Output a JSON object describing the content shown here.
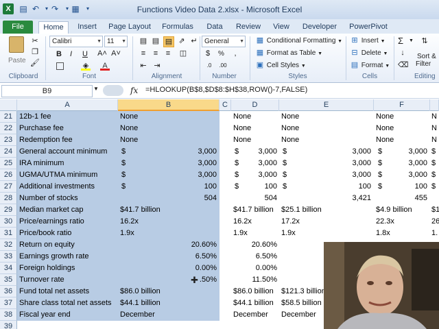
{
  "window": {
    "title": "Functions Video Data 2.xlsx - Microsoft Excel"
  },
  "tabs": [
    "File",
    "Home",
    "Insert",
    "Page Layout",
    "Formulas",
    "Data",
    "Review",
    "View",
    "Developer",
    "PowerPivot"
  ],
  "ribbon": {
    "groups": {
      "clipboard": "Clipboard",
      "font": "Font",
      "alignment": "Alignment",
      "number": "Number",
      "styles": "Styles",
      "cells": "Cells",
      "editing": "Editing"
    },
    "paste_label": "Paste",
    "font_name": "Calibri",
    "font_size": "11",
    "number_format": "General",
    "conditional_formatting": "Conditional Formatting",
    "format_as_table": "Format as Table",
    "cell_styles": "Cell Styles",
    "insert": "Insert",
    "delete": "Delete",
    "format": "Format",
    "sort_filter_1": "Sort &",
    "sort_filter_2": "Filter",
    "bold": "B",
    "italic": "I",
    "underline": "U",
    "sigma": "Σ",
    "percent": "%",
    "fx": "fx"
  },
  "formula_bar": {
    "name_box": "B9",
    "formula": "=HLOOKUP(B$8,$D$8:$H$38,ROW()-7,FALSE)"
  },
  "columns": [
    "A",
    "B",
    "C",
    "D",
    "E",
    "F"
  ],
  "rows": [
    {
      "num": "21",
      "a": "12b-1 fee",
      "b": "None",
      "b_sym": "",
      "d": "None",
      "d_sym": "",
      "e": "None",
      "e_sym": "",
      "f": "None",
      "f_sym": "",
      "g": "N"
    },
    {
      "num": "22",
      "a": "Purchase fee",
      "b": "None",
      "b_sym": "",
      "d": "None",
      "d_sym": "",
      "e": "None",
      "e_sym": "",
      "f": "None",
      "f_sym": "",
      "g": "N"
    },
    {
      "num": "23",
      "a": "Redemption fee",
      "b": "None",
      "b_sym": "",
      "d": "None",
      "d_sym": "",
      "e": "None",
      "e_sym": "",
      "f": "None",
      "f_sym": "",
      "g": "N"
    },
    {
      "num": "24",
      "a": "General account minimum",
      "b": "3,000",
      "b_sym": "$",
      "d": "3,000",
      "d_sym": "$",
      "e": "3,000",
      "e_sym": "$",
      "f": "3,000",
      "f_sym": "$",
      "g": "$"
    },
    {
      "num": "25",
      "a": "IRA minimum",
      "b": "3,000",
      "b_sym": "$",
      "d": "3,000",
      "d_sym": "$",
      "e": "3,000",
      "e_sym": "$",
      "f": "3,000",
      "f_sym": "$",
      "g": "$"
    },
    {
      "num": "26",
      "a": "UGMA/UTMA minimum",
      "b": "3,000",
      "b_sym": "$",
      "d": "3,000",
      "d_sym": "$",
      "e": "3,000",
      "e_sym": "$",
      "f": "3,000",
      "f_sym": "$",
      "g": "$"
    },
    {
      "num": "27",
      "a": "Additional investments",
      "b": "100",
      "b_sym": "$",
      "d": "100",
      "d_sym": "$",
      "e": "100",
      "e_sym": "$",
      "f": "100",
      "f_sym": "$",
      "g": "$"
    },
    {
      "num": "28",
      "a": "Number of stocks",
      "b": "504",
      "b_sym": "",
      "d": "504",
      "d_sym": "",
      "e": "3,421",
      "e_sym": "",
      "f": "455",
      "f_sym": "",
      "g": ""
    },
    {
      "num": "29",
      "a": "Median market cap",
      "b": "$41.7 billion",
      "b_sym": "",
      "d": "$41.7 billion",
      "d_sym": "",
      "e": "$25.1 billion",
      "e_sym": "",
      "f": "$4.9 billion",
      "f_sym": "",
      "g": "$1"
    },
    {
      "num": "30",
      "a": "Price/earnings ratio",
      "b": "16.2x",
      "b_sym": "",
      "d": "16.2x",
      "d_sym": "",
      "e": "17.2x",
      "e_sym": "",
      "f": "22.3x",
      "f_sym": "",
      "g": "26"
    },
    {
      "num": "31",
      "a": "Price/book ratio",
      "b": "1.9x",
      "b_sym": "",
      "d": "1.9x",
      "d_sym": "",
      "e": "1.9x",
      "e_sym": "",
      "f": "1.8x",
      "f_sym": "",
      "g": "1."
    },
    {
      "num": "32",
      "a": "Return on equity",
      "b": "20.60%",
      "b_sym": "",
      "d": "20.60%",
      "d_sym": "",
      "e": "",
      "e_sym": "",
      "f": "",
      "f_sym": "",
      "g": ""
    },
    {
      "num": "33",
      "a": "Earnings growth rate",
      "b": "6.50%",
      "b_sym": "",
      "d": "6.50%",
      "d_sym": "",
      "e": "",
      "e_sym": "",
      "f": "",
      "f_sym": "",
      "g": ""
    },
    {
      "num": "34",
      "a": "Foreign holdings",
      "b": "0.00%",
      "b_sym": "",
      "d": "0.00%",
      "d_sym": "",
      "e": "",
      "e_sym": "",
      "f": "",
      "f_sym": "",
      "g": ""
    },
    {
      "num": "35",
      "a": "Turnover rate",
      "b": ".50%",
      "b_sym": "",
      "d": "11.50%",
      "d_sym": "",
      "e": "",
      "e_sym": "",
      "f": "",
      "f_sym": "",
      "g": ""
    },
    {
      "num": "36",
      "a": "Fund total net assets",
      "b": "$86.0 billion",
      "b_sym": "",
      "d": "$86.0 billion",
      "d_sym": "",
      "e": "$121.3 billion",
      "e_sym": "",
      "f": "",
      "f_sym": "",
      "g": ""
    },
    {
      "num": "37",
      "a": "Share class total net assets",
      "b": "$44.1 billion",
      "b_sym": "",
      "d": "$44.1 billion",
      "d_sym": "",
      "e": "$58.5 billion",
      "e_sym": "",
      "f": "",
      "f_sym": "",
      "g": ""
    },
    {
      "num": "38",
      "a": "Fiscal year end",
      "b": "December",
      "b_sym": "",
      "d": "December",
      "d_sym": "",
      "e": "December",
      "e_sym": "",
      "f": "",
      "f_sym": "",
      "g": ""
    },
    {
      "num": "39",
      "a": "",
      "b": "",
      "b_sym": "",
      "d": "",
      "d_sym": "",
      "e": "",
      "e_sym": "",
      "f": "",
      "f_sym": "",
      "g": ""
    }
  ],
  "colors": {
    "selection": "#b8cce4",
    "file_tab": "#2a8a3e",
    "header_selected": "#f9d98a"
  }
}
